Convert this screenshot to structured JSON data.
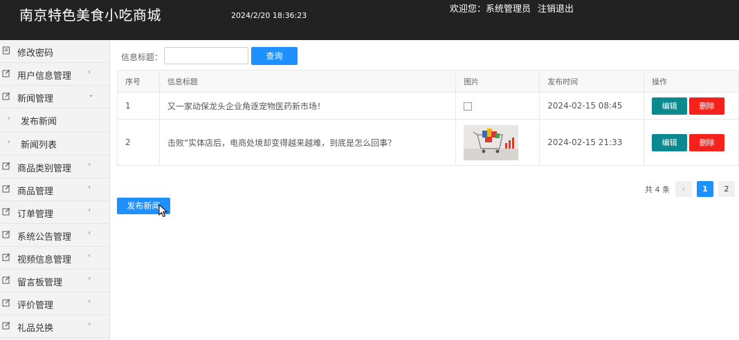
{
  "header": {
    "title": "南京特色美食小吃商城",
    "datetime": "2024/2/20 18:36:23",
    "welcome": "欢迎您：系统管理员",
    "logout": "注销退出"
  },
  "sidebar": {
    "items": [
      {
        "label": "修改密码",
        "icon": "lock-icon"
      },
      {
        "label": "用户信息管理",
        "icon": "edit-icon"
      },
      {
        "label": "新闻管理",
        "icon": "edit-icon"
      },
      {
        "label": "发布新闻"
      },
      {
        "label": "新闻列表"
      },
      {
        "label": "商品类别管理",
        "icon": "edit-icon"
      },
      {
        "label": "商品管理",
        "icon": "edit-icon"
      },
      {
        "label": "订单管理",
        "icon": "edit-icon"
      },
      {
        "label": "系统公告管理",
        "icon": "edit-icon"
      },
      {
        "label": "视频信息管理",
        "icon": "edit-icon"
      },
      {
        "label": "留言板管理",
        "icon": "edit-icon"
      },
      {
        "label": "评价管理",
        "icon": "edit-icon"
      },
      {
        "label": "礼品兑换",
        "icon": "edit-icon"
      }
    ],
    "arrow_collapsed": "‹",
    "arrow_expanded": "⌄",
    "sub_arrow": "›"
  },
  "search": {
    "label": "信息标题：",
    "value": "",
    "placeholder": "",
    "button": "查询"
  },
  "table": {
    "headers": [
      "序号",
      "信息标题",
      "图片",
      "发布时间",
      "操作"
    ],
    "rows": [
      {
        "index": "1",
        "title": "又一家动保龙头企业角逐宠物医药新市场！",
        "time": "2024-02-15 08:45"
      },
      {
        "index": "2",
        "title": "击败”实体店后，电商处境却变得越来越难，到底是怎么回事？",
        "time": "2024-02-15 21:33"
      }
    ],
    "edit_label": "编辑",
    "delete_label": "删除"
  },
  "pagination": {
    "total": "共 4 条",
    "prev": "‹",
    "pages": [
      "1",
      "2"
    ],
    "current": 1
  },
  "publish_button": "发布新闻",
  "colors": {
    "header_bg": "#222222",
    "primary": "#1e90ff",
    "edit": "#0a8a8f",
    "delete": "#f5221b",
    "sidebar_bg": "#f3f3f3"
  }
}
